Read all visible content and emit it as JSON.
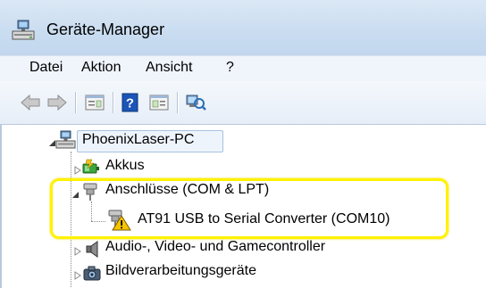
{
  "window": {
    "title": "Geräte-Manager",
    "title_icon": "device-manager-icon"
  },
  "menu": {
    "items": [
      "Datei",
      "Aktion",
      "Ansicht",
      "?"
    ]
  },
  "toolbar": {
    "buttons": [
      "back-arrow-icon",
      "forward-arrow-icon",
      "properties-icon",
      "help-icon",
      "update-driver-icon",
      "scan-hardware-icon"
    ]
  },
  "tree": {
    "root": {
      "label": "PhoenixLaser-PC",
      "icon": "computer-icon",
      "expanded": true
    },
    "items": [
      {
        "label": "Akkus",
        "icon": "battery-icon",
        "expanded": false
      },
      {
        "label": "Anschlüsse (COM & LPT)",
        "icon": "port-connector-icon",
        "expanded": true,
        "children": [
          {
            "label": "AT91 USB to Serial Converter (COM10)",
            "icon": "warning-port-icon",
            "status": "warning"
          }
        ]
      },
      {
        "label": "Audio-, Video- und Gamecontroller",
        "icon": "speaker-icon",
        "expanded": false
      },
      {
        "label": "Bildverarbeitungsgeräte",
        "icon": "camera-icon",
        "expanded": false
      }
    ]
  },
  "colors": {
    "titlebar": "#c9dcf0",
    "selection_border": "#a6c2e0",
    "highlight": "#fff200",
    "warning": "#f5c400"
  }
}
